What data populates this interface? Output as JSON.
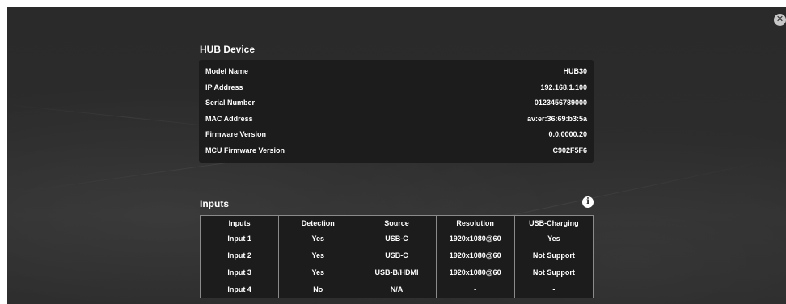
{
  "close": {
    "icon": "close-icon",
    "glyph": "✕"
  },
  "hub": {
    "title": "HUB Device",
    "rows": [
      {
        "label": "Model Name",
        "value": "HUB30"
      },
      {
        "label": "IP Address",
        "value": "192.168.1.100"
      },
      {
        "label": "Serial Number",
        "value": "0123456789000"
      },
      {
        "label": "MAC Address",
        "value": "av:er:36:69:b3:5a"
      },
      {
        "label": "Firmware Version",
        "value": "0.0.0000.20"
      },
      {
        "label": "MCU Firmware Version",
        "value": "C902F5F6"
      }
    ]
  },
  "inputs": {
    "title": "Inputs",
    "info_icon": "info-icon",
    "info_glyph": "i",
    "headers": [
      "Inputs",
      "Detection",
      "Source",
      "Resolution",
      "USB-Charging"
    ],
    "rows": [
      [
        "Input 1",
        "Yes",
        "USB-C",
        "1920x1080@60",
        "Yes"
      ],
      [
        "Input 2",
        "Yes",
        "USB-C",
        "1920x1080@60",
        "Not Support"
      ],
      [
        "Input 3",
        "Yes",
        "USB-B/HDMI",
        "1920x1080@60",
        "Not Support"
      ],
      [
        "Input 4",
        "No",
        "N/A",
        "-",
        "-"
      ]
    ]
  }
}
